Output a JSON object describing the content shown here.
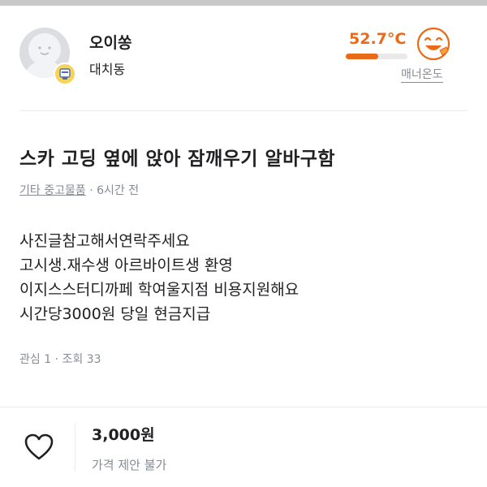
{
  "profile": {
    "nickname": "오이쏭",
    "region": "대치동",
    "manner_temperature": "52.7°C",
    "manner_fill_fraction": 0.53,
    "manner_label": "매너온도",
    "temperature_color": "#e96a17"
  },
  "post": {
    "title": "스카 고딩 옆에 앉아 잠깨우기 알바구함",
    "category": "기타 중고물품",
    "time_ago": "6시간 전",
    "body_lines": [
      "사진글참고해서연락주세요",
      "고시생.재수생 아르바이트생 환영",
      "이지스스터디까페 학여울지점 비용지원해요",
      "시간당3000원 당일 현금지급"
    ],
    "interest": "관심 1",
    "views": "조회 33"
  },
  "bottom_bar": {
    "price": "3,000원",
    "price_note": "가격 제안 불가"
  },
  "icons": {
    "avatar": "default-avatar-icon",
    "badge": "verified-badge-icon",
    "temperature": "happy-face-icon",
    "like": "heart-icon"
  }
}
